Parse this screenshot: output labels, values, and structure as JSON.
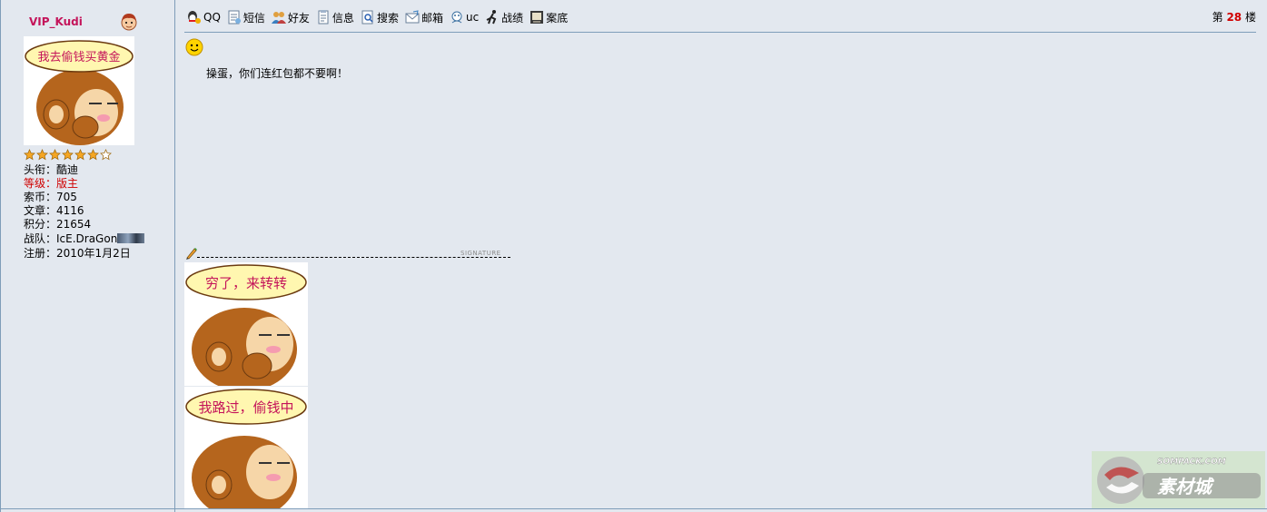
{
  "sidebar": {
    "username": "VIP_Kudi",
    "avatar_bubble": "我去偷钱买黄金",
    "stars": 7,
    "stars_filled": 6,
    "title_line": "头衔：酷迪",
    "level_line": "等级：版主",
    "coins_line": "索币：705",
    "posts_line": "文章：4116",
    "points_line": "积分：21654",
    "team_line": "战队：IcE.DraGon",
    "reg_line": "注册：2010年1月2日"
  },
  "toolbar": {
    "items": [
      {
        "label": "QQ",
        "icon": "qq-icon"
      },
      {
        "label": "短信",
        "icon": "message-icon"
      },
      {
        "label": "好友",
        "icon": "friends-icon"
      },
      {
        "label": "信息",
        "icon": "info-icon"
      },
      {
        "label": "搜索",
        "icon": "search-icon"
      },
      {
        "label": "邮箱",
        "icon": "mail-icon"
      },
      {
        "label": "uc",
        "icon": "uc-icon"
      },
      {
        "label": "战绩",
        "icon": "record-icon"
      },
      {
        "label": "案底",
        "icon": "file-icon"
      }
    ],
    "floor_prefix": "第",
    "floor_number": "28",
    "floor_suffix": "楼"
  },
  "post": {
    "text": "操蛋，你们连红包都不要啊！"
  },
  "signature": {
    "label": "SIGNATURE",
    "image1_bubble": "穷了，来转转",
    "image2_bubble": "我路过，偷钱中"
  },
  "watermark": {
    "text": "SOMPACK.COM",
    "brand": "素材城"
  },
  "colors": {
    "background": "#e3e8ef",
    "border": "#7f9db9",
    "username": "#c4145a",
    "highlight_red": "#d00000"
  }
}
